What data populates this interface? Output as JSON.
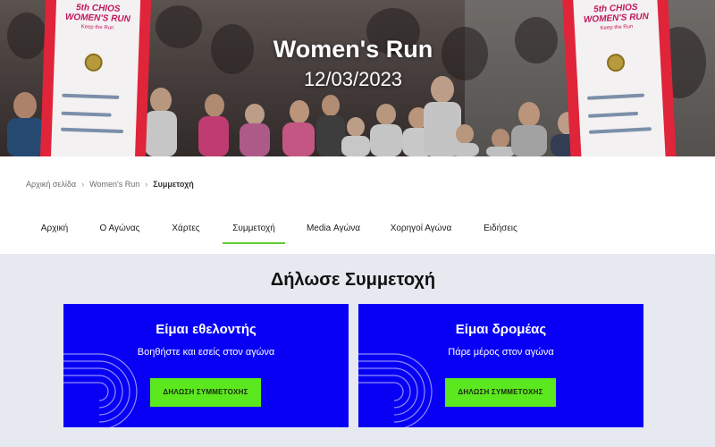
{
  "hero": {
    "title": "Women's Run",
    "date": "12/03/2023",
    "banner_text": "5th CHIOS WOMEN'S RUN",
    "banner_subtext": "Keep the Run"
  },
  "breadcrumb": [
    {
      "label": "Αρχική σελίδα"
    },
    {
      "label": "Women's Run"
    },
    {
      "label": "Συμμετοχή"
    }
  ],
  "tabs": [
    {
      "label": "Αρχική"
    },
    {
      "label": "Ο Αγώνας"
    },
    {
      "label": "Χάρτες"
    },
    {
      "label": "Συμμετοχή"
    },
    {
      "label": "Media Αγώνα"
    },
    {
      "label": "Χορηγοί Αγώνα"
    },
    {
      "label": "Ειδήσεις"
    }
  ],
  "active_tab": "Συμμετοχή",
  "section": {
    "title": "Δήλωσε Συμμετοχή",
    "cards": [
      {
        "title": "Είμαι εθελοντής",
        "description": "Βοηθήστε και εσείς στον αγώνα",
        "button": "ΔΗΛΩΣΗ ΣΥΜΜΕΤΟΧΗΣ"
      },
      {
        "title": "Είμαι δρομέας",
        "description": "Πάρε μέρος στον αγώνα",
        "button": "ΔΗΛΩΣΗ ΣΥΜΜΕΤΟΧΗΣ"
      }
    ]
  },
  "colors": {
    "card_bg": "#0800f5",
    "button_bg": "#5ce81e",
    "tab_underline": "#5fcc2e",
    "section_bg": "#e6e9ef",
    "banner_red": "#e0243a"
  },
  "icons": [
    "chevron-right-icon",
    "track-lines-icon"
  ]
}
